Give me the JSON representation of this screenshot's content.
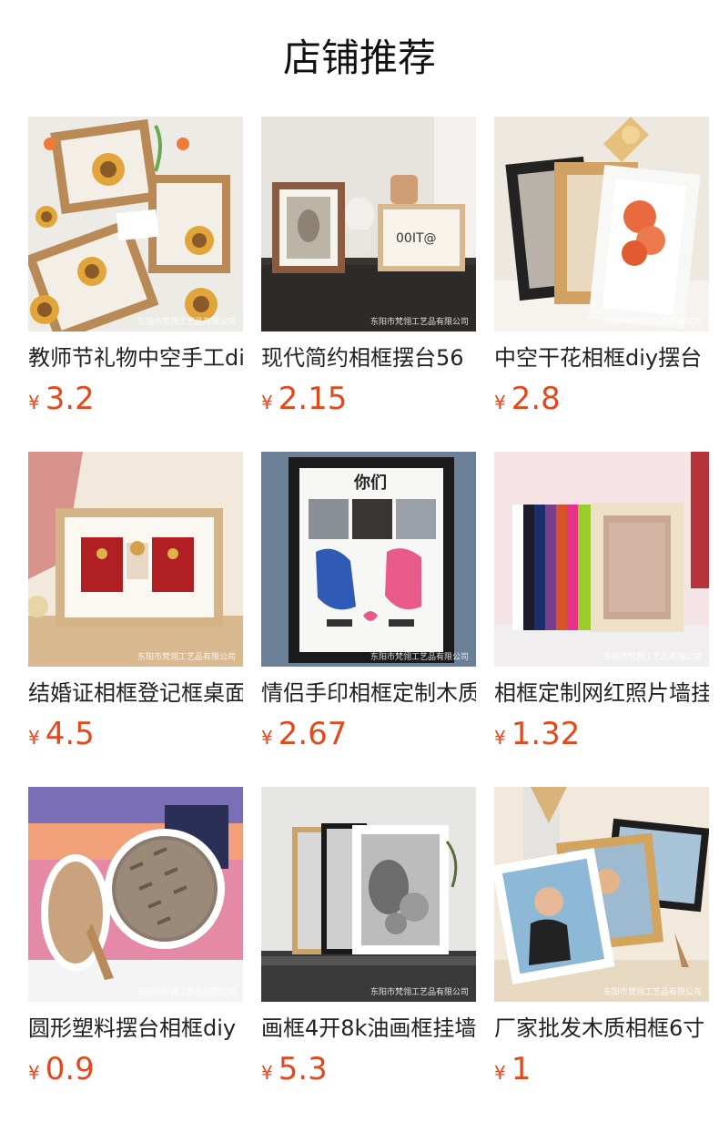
{
  "shop": {
    "title": "店铺推荐"
  },
  "currency_symbol": "¥",
  "watermark": "东阳市梵翎工艺品有限公司",
  "colors": {
    "price": "#e5481c",
    "title_text": "#111111",
    "name_text": "#222222"
  },
  "products": [
    {
      "name": "教师节礼物中空手工diy",
      "price": "3.2",
      "image": "teacher-day-flower-frames-image"
    },
    {
      "name": "现代简约相框摆台56",
      "price": "2.15",
      "image": "modern-photo-frames-desk-image"
    },
    {
      "name": "中空干花相框diy摆台",
      "price": "2.8",
      "image": "hollow-dried-flower-frames-image"
    },
    {
      "name": "结婚证相框登记框桌面",
      "price": "4.5",
      "image": "marriage-certificate-frame-image"
    },
    {
      "name": "情侣手印相框定制木质",
      "price": "2.67",
      "image": "couple-handprint-frame-image"
    },
    {
      "name": "相框定制网红照片墙挂",
      "price": "1.32",
      "image": "colorful-frames-stack-image"
    },
    {
      "name": "圆形塑料摆台相框diy",
      "price": "0.9",
      "image": "round-plastic-frames-image"
    },
    {
      "name": "画框4开8k油画框挂墙",
      "price": "5.3",
      "image": "painting-frames-sketch-image"
    },
    {
      "name": "厂家批发木质相框6寸",
      "price": "1",
      "image": "wooden-photo-frames-image"
    }
  ]
}
